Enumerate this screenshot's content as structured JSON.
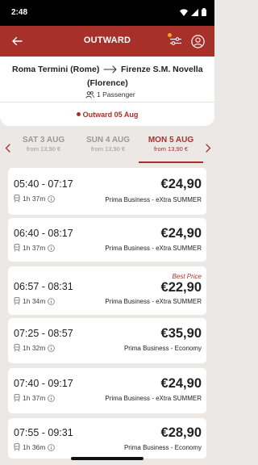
{
  "status_bar": {
    "time": "2:48"
  },
  "app_bar": {
    "title": "OUTWARD"
  },
  "route": {
    "from": "Roma Termini (Rome)",
    "to": "Firenze S.M. Novella",
    "to_sub": "(Florence)",
    "passengers": "1 Passenger",
    "outward_date": "Outward 05 Aug"
  },
  "dates": [
    {
      "label": "SAT 3 AUG",
      "price": "from 13,90 €"
    },
    {
      "label": "SUN 4 AUG",
      "price": "from 13,90 €"
    },
    {
      "label": "MON 5 AUG",
      "price": "from 13,90 €"
    }
  ],
  "trains": [
    {
      "times": "05:40 - 07:17",
      "duration": "1h 37m",
      "price": "€24,90",
      "service": "Prima Business - eXtra SUMMER",
      "badge": ""
    },
    {
      "times": "06:40 - 08:17",
      "duration": "1h 37m",
      "price": "€24,90",
      "service": "Prima Business - eXtra SUMMER",
      "badge": ""
    },
    {
      "times": "06:57 - 08:31",
      "duration": "1h 34m",
      "price": "€22,90",
      "service": "Prima Business - eXtra SUMMER",
      "badge": "Best Price"
    },
    {
      "times": "07:25 - 08:57",
      "duration": "1h 32m",
      "price": "€35,90",
      "service": "Prima Business - Economy",
      "badge": ""
    },
    {
      "times": "07:40 - 09:17",
      "duration": "1h 37m",
      "price": "€24,90",
      "service": "Prima Business - eXtra SUMMER",
      "badge": ""
    },
    {
      "times": "07:55 - 09:31",
      "duration": "1h 36m",
      "price": "€28,90",
      "service": "Prima Business - Economy",
      "badge": ""
    }
  ],
  "colors": {
    "brand": "#a8302a",
    "accent_dot": "#f2a61d",
    "background": "#ece8e6"
  }
}
